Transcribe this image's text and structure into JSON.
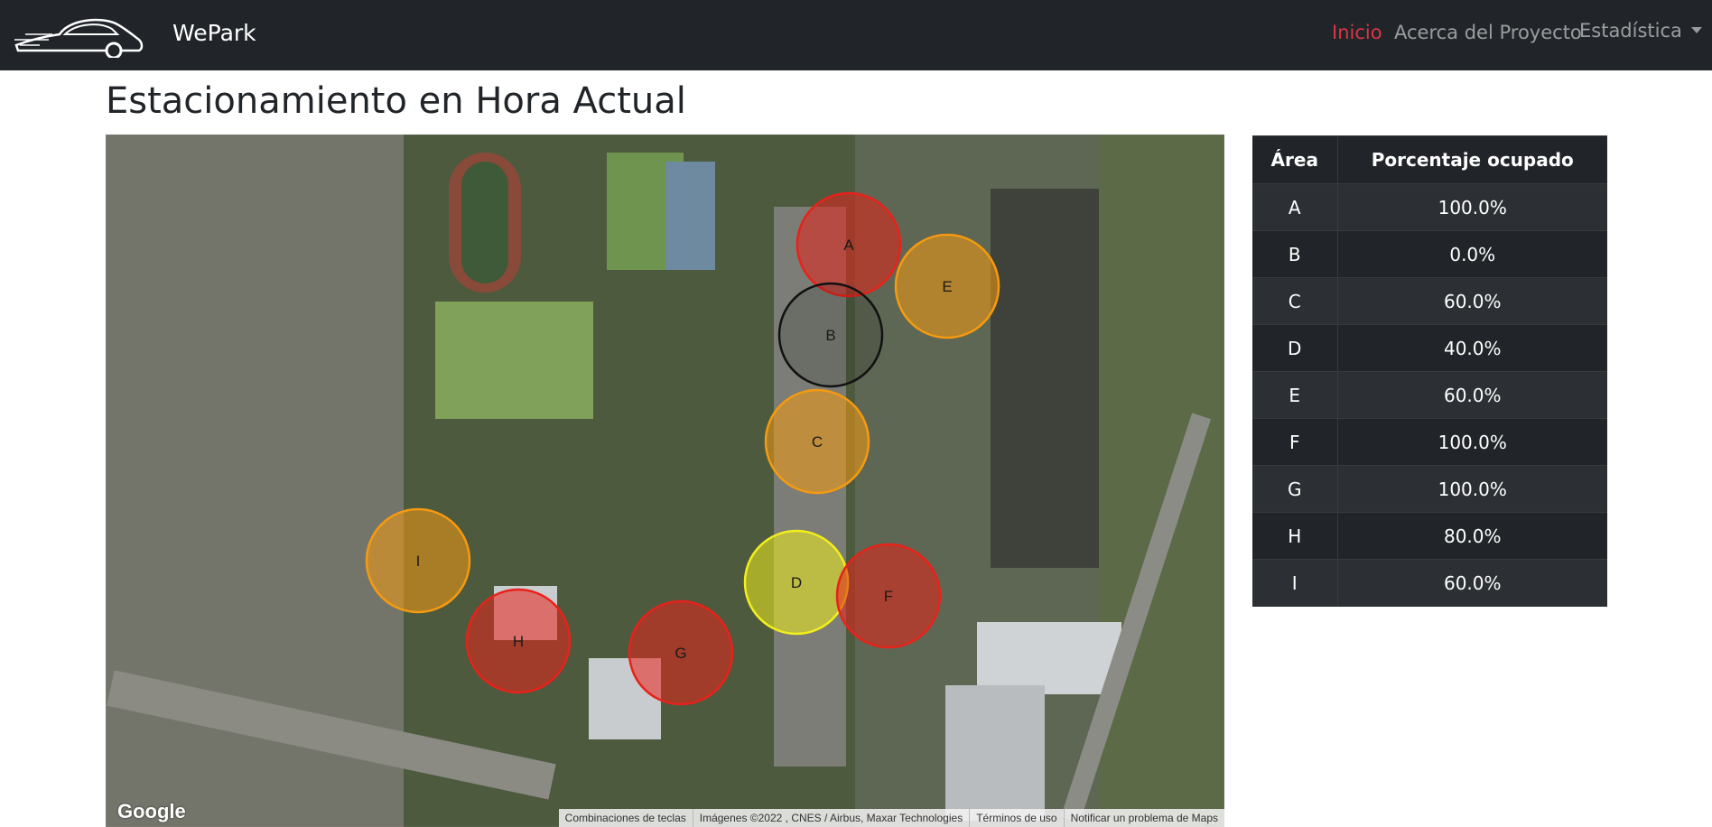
{
  "navbar": {
    "brand": "WePark",
    "items": [
      {
        "label": "Inicio",
        "active": true
      },
      {
        "label": "Acerca del Proyecto",
        "active": false
      },
      {
        "label": "Estadística",
        "active": false
      }
    ]
  },
  "page": {
    "title": "Estacionamiento en Hora Actual"
  },
  "map": {
    "areas": [
      {
        "label": "A",
        "color": "#e8221a"
      },
      {
        "label": "E",
        "color": "#f59a10"
      },
      {
        "label": "B",
        "color": "#111111"
      },
      {
        "label": "C",
        "color": "#f59a10"
      },
      {
        "label": "I",
        "color": "#f59a10"
      },
      {
        "label": "D",
        "color": "#f2ee1c"
      },
      {
        "label": "F",
        "color": "#e8221a"
      },
      {
        "label": "H",
        "color": "#e8221a"
      },
      {
        "label": "G",
        "color": "#e8221a"
      }
    ],
    "google_logo": "Google",
    "attribution": [
      "Combinaciones de teclas",
      "Imágenes ©2022 , CNES / Airbus, Maxar Technologies",
      "Términos de uso",
      "Notificar un problema de Maps"
    ]
  },
  "table": {
    "headers": [
      "Área",
      "Porcentaje ocupado"
    ],
    "rows": [
      {
        "area": "A",
        "percent": "100.0%"
      },
      {
        "area": "B",
        "percent": "0.0%"
      },
      {
        "area": "C",
        "percent": "60.0%"
      },
      {
        "area": "D",
        "percent": "40.0%"
      },
      {
        "area": "E",
        "percent": "60.0%"
      },
      {
        "area": "F",
        "percent": "100.0%"
      },
      {
        "area": "G",
        "percent": "100.0%"
      },
      {
        "area": "H",
        "percent": "80.0%"
      },
      {
        "area": "I",
        "percent": "60.0%"
      }
    ]
  }
}
